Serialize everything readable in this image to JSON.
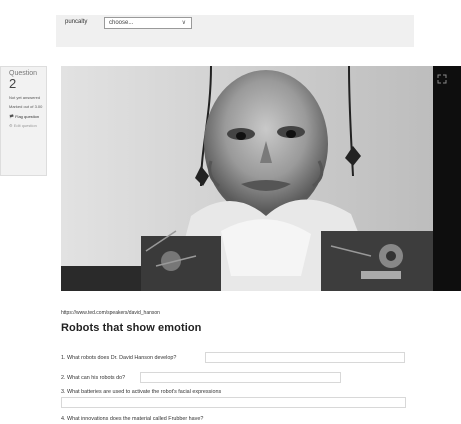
{
  "top_bar": {
    "select_label": "puncalty",
    "select_value": "choose..."
  },
  "question_info": {
    "label": "Question",
    "number": "2",
    "status": "Not yet answered",
    "marks": "Marked out of 3.00",
    "flag": "Flag question",
    "edit": "Edit question"
  },
  "video": {
    "expand_icon": "expand-icon"
  },
  "content": {
    "url": "https://www.ted.com/speakers/david_hanson",
    "title": "Robots that show emotion",
    "questions": [
      "1. What robots does Dr. David Hanson develop?",
      "2. What can his robots do?",
      "3. What batteries are used to activate the robot's facial expressions",
      "4. What innovations does the material called Frubber have?"
    ]
  }
}
